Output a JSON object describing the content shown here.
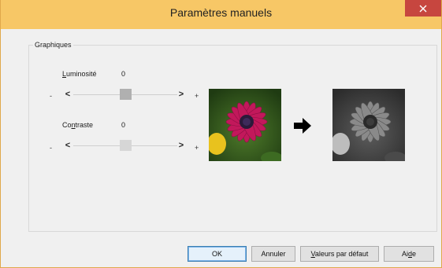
{
  "window": {
    "title": "Paramètres manuels",
    "close_glyph": "×"
  },
  "group": {
    "label": "Graphiques"
  },
  "brightness": {
    "label_first": "L",
    "label_rest": "uminosité",
    "value": "0",
    "minus": "-",
    "plus": "+",
    "left_arrow": "<",
    "right_arrow": ">",
    "level": 0.5
  },
  "contrast": {
    "label_pre": "Co",
    "label_u": "n",
    "label_post": "traste",
    "value": "0",
    "minus": "-",
    "plus": "+",
    "left_arrow": "<",
    "right_arrow": ">",
    "level": 0.5
  },
  "preview": {
    "arrow_icon": "right-arrow-icon",
    "original_icon": "flower-color-image",
    "result_icon": "flower-grayscale-image"
  },
  "buttons": {
    "ok": "OK",
    "cancel": "Annuler",
    "defaults_u": "V",
    "defaults_rest": "aleurs par défaut",
    "help_pre": "Ai",
    "help_u": "d",
    "help_post": "e"
  },
  "colors": {
    "titlebar": "#f7c766",
    "close": "#c7463f",
    "flower": "#c2185b"
  }
}
